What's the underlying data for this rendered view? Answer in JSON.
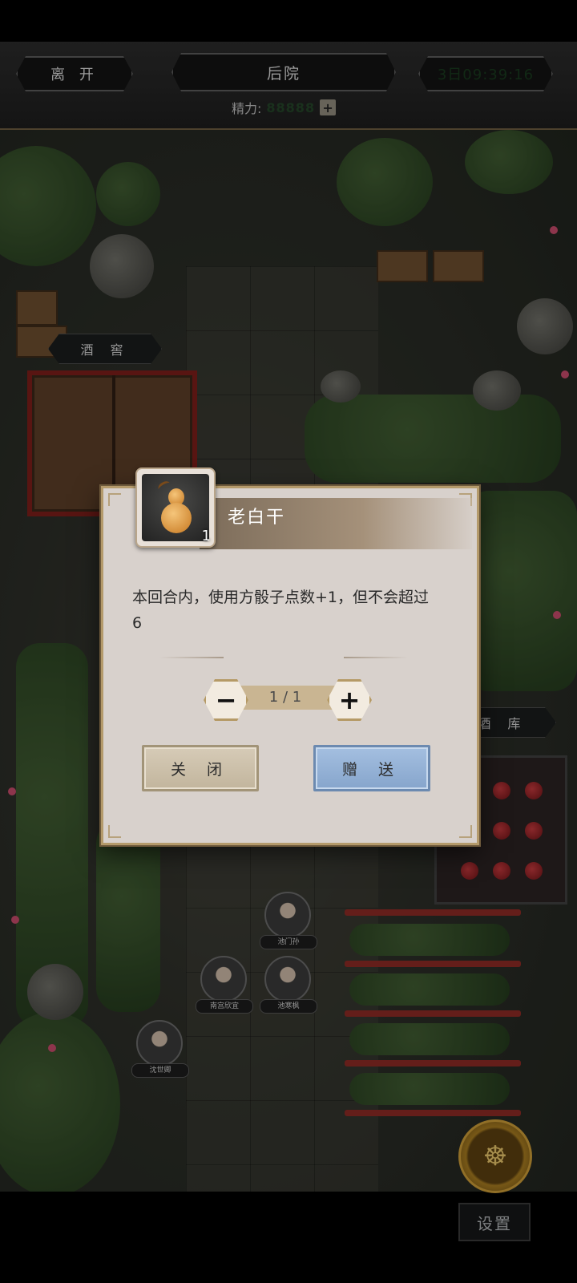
{
  "topbar": {
    "leave_label": "离 开",
    "location_title": "后院",
    "timer": "3日09:39:16",
    "energy_label": "精力:",
    "energy_value": "88888",
    "energy_add": "+"
  },
  "scene": {
    "labels": {
      "cellar": "酒 窖",
      "wine_store": "酒 库"
    },
    "characters": [
      {
        "name": "池门孙"
      },
      {
        "name": "南宫欣宜"
      },
      {
        "name": "池寒枫"
      },
      {
        "name": "沈世卿"
      }
    ],
    "settings_label": "设置"
  },
  "dialog": {
    "item_name": "老白干",
    "item_count": "1",
    "description": "本回合内，使用方骰子点数+1，但不会超过6",
    "quantity": "1 / 1",
    "minus": "−",
    "plus": "+",
    "close_label": "关 闭",
    "gift_label": "赠 送"
  },
  "colors": {
    "timer_green": "#2fae43",
    "gift_blue": "#86a5cc",
    "close_beige": "#c2b59d"
  }
}
